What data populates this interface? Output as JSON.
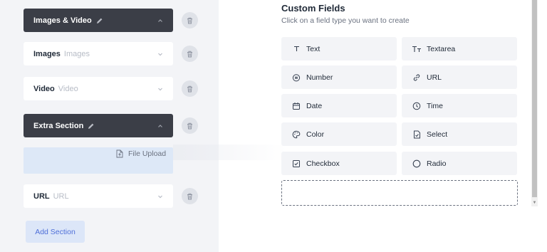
{
  "sections": [
    {
      "title": "Images & Video",
      "subtitle": "",
      "style": "dark",
      "pencil": true,
      "chevron": "up"
    },
    {
      "title": "Images",
      "subtitle": "Images",
      "style": "light",
      "pencil": false,
      "chevron": "down"
    },
    {
      "title": "Video",
      "subtitle": "Video",
      "style": "light",
      "pencil": false,
      "chevron": "down"
    },
    {
      "title": "Extra Section",
      "subtitle": "",
      "style": "dark",
      "pencil": true,
      "chevron": "up"
    },
    {
      "title": "URL",
      "subtitle": "URL",
      "style": "light",
      "pencil": false,
      "chevron": "down"
    }
  ],
  "drag_ghost": {
    "label": "File Upload",
    "icon": "file-upload-icon"
  },
  "add_section_label": "Add Section",
  "custom_fields": {
    "title": "Custom Fields",
    "subtitle": "Click on a field type you want to create",
    "types": [
      {
        "label": "Text",
        "icon": "text-icon"
      },
      {
        "label": "Textarea",
        "icon": "textarea-icon"
      },
      {
        "label": "Number",
        "icon": "number-icon"
      },
      {
        "label": "URL",
        "icon": "link-icon"
      },
      {
        "label": "Date",
        "icon": "calendar-icon"
      },
      {
        "label": "Time",
        "icon": "clock-icon"
      },
      {
        "label": "Color",
        "icon": "palette-icon"
      },
      {
        "label": "Select",
        "icon": "select-icon"
      },
      {
        "label": "Checkbox",
        "icon": "checkbox-icon"
      },
      {
        "label": "Radio",
        "icon": "radio-icon"
      }
    ]
  },
  "colors": {
    "dark_section": "#3b3e47",
    "panel_bg": "#f3f4f7",
    "accent": "#4f6fd8",
    "drop_zone": "#dde8f7"
  }
}
